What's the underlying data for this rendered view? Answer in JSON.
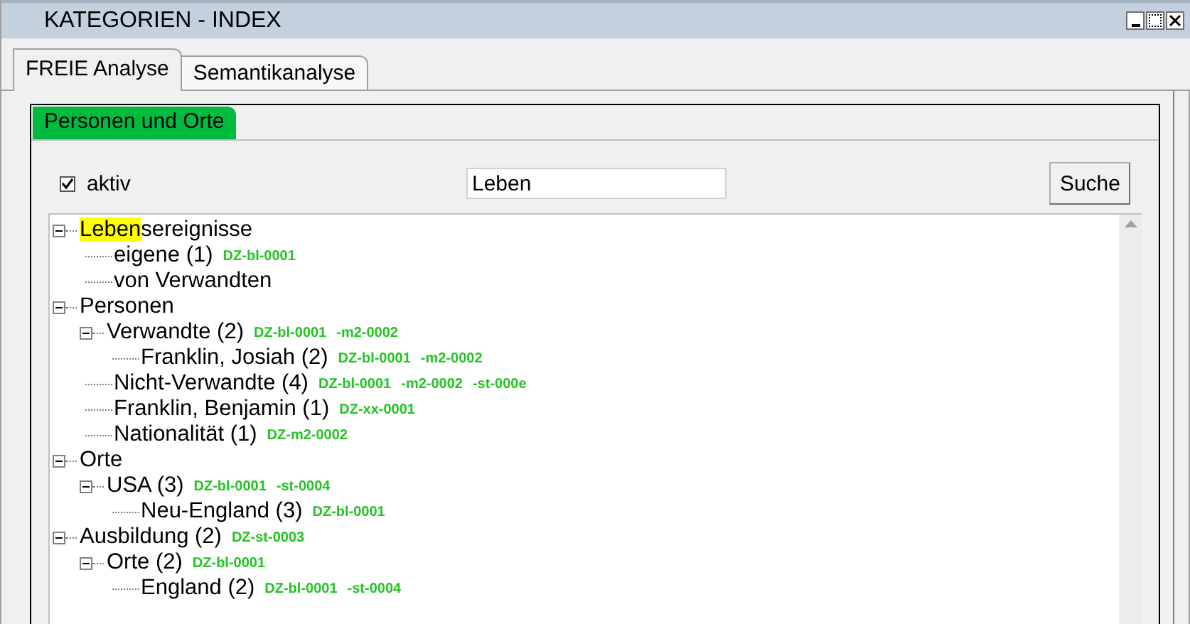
{
  "window": {
    "title": "KATEGORIEN - INDEX"
  },
  "tabs": [
    {
      "label": "FREIE Analyse",
      "selected": true
    },
    {
      "label": "Semantikanalyse",
      "selected": false
    }
  ],
  "subtabs": [
    {
      "label": "Personen und Orte",
      "selected": true
    }
  ],
  "aktiv": {
    "label": "aktiv",
    "checked": true
  },
  "search": {
    "value": "Leben"
  },
  "search_button": "Suche",
  "tree": [
    {
      "highlight": "Leben",
      "label": "sereignisse",
      "expanded": true,
      "children": [
        {
          "label": "eigene (1)",
          "codes": [
            "DZ-bl-0001"
          ]
        },
        {
          "label": "von Verwandten"
        }
      ]
    },
    {
      "label": "Personen",
      "expanded": true,
      "children": [
        {
          "label": "Verwandte (2)",
          "codes": [
            "DZ-bl-0001",
            "-m2-0002"
          ],
          "expanded": true,
          "children": [
            {
              "label": "Franklin, Josiah (2)",
              "codes": [
                "DZ-bl-0001",
                "-m2-0002"
              ]
            }
          ]
        },
        {
          "label": "Nicht-Verwandte (4)",
          "codes": [
            "DZ-bl-0001",
            "-m2-0002",
            "-st-000e"
          ]
        },
        {
          "label": "Franklin, Benjamin (1)",
          "codes": [
            "DZ-xx-0001"
          ]
        },
        {
          "label": "Nationalität (1)",
          "codes": [
            "DZ-m2-0002"
          ]
        }
      ]
    },
    {
      "label": "Orte",
      "expanded": true,
      "children": [
        {
          "label": "USA (3)",
          "codes": [
            "DZ-bl-0001",
            "-st-0004"
          ],
          "expanded": true,
          "children": [
            {
              "label": "Neu-England (3)",
              "codes": [
                "DZ-bl-0001"
              ]
            }
          ]
        }
      ]
    },
    {
      "label": "Ausbildung (2)",
      "codes": [
        "DZ-st-0003"
      ],
      "expanded": true,
      "children": [
        {
          "label": "Orte (2)",
          "codes": [
            "DZ-bl-0001"
          ],
          "expanded": true,
          "children": [
            {
              "label": "England (2)",
              "codes": [
                "DZ-bl-0001",
                "-st-0004"
              ]
            }
          ]
        }
      ]
    }
  ]
}
